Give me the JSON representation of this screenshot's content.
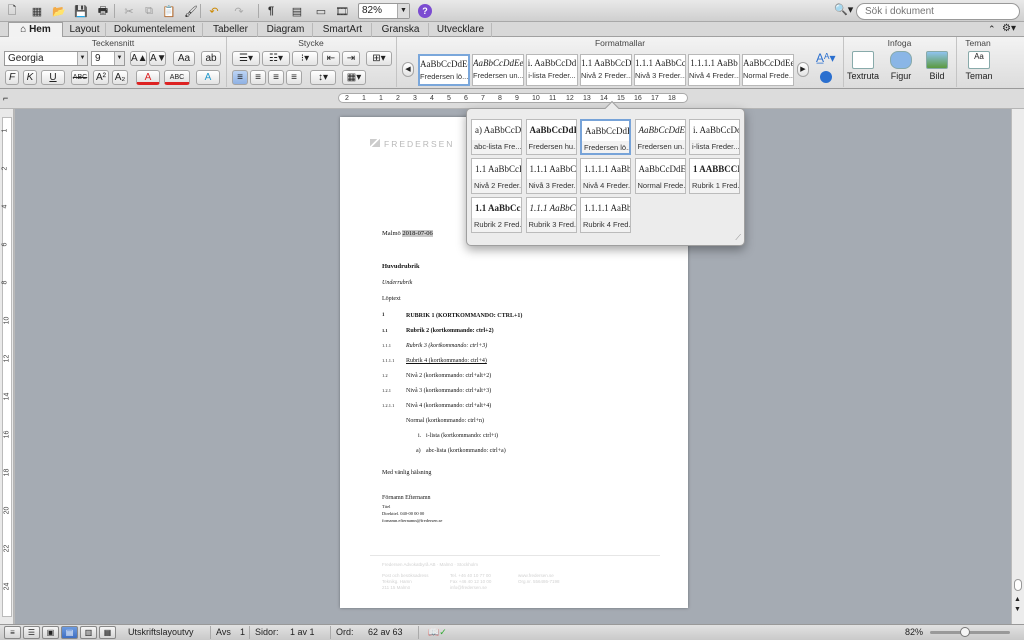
{
  "toolbar": {
    "zoom_value": "82%",
    "help_label": "?",
    "search_placeholder": "Sök i dokument",
    "icons": [
      "new-document-icon",
      "gallery-icon",
      "open-icon",
      "save-icon",
      "print-icon",
      "cut-icon",
      "copy-icon",
      "paste-icon",
      "format-painter-icon",
      "undo-icon",
      "redo-icon",
      "pilcrow-icon",
      "sidebar-icon",
      "view-icon",
      "media-icon",
      "help-icon"
    ]
  },
  "tabs": [
    {
      "label": "Hem",
      "active": true
    },
    {
      "label": "Layout"
    },
    {
      "label": "Dokumentelement"
    },
    {
      "label": "Tabeller"
    },
    {
      "label": "Diagram"
    },
    {
      "label": "SmartArt"
    },
    {
      "label": "Granska"
    },
    {
      "label": "Utvecklare"
    }
  ],
  "ribbon": {
    "groups": {
      "font": "Teckensnitt",
      "paragraph": "Stycke",
      "styles": "Formatmallar",
      "insert": "Infoga",
      "themes": "Teman"
    },
    "font_name": "Georgia",
    "font_size": "9",
    "font_buttons": [
      "A▲",
      "A▼",
      "Aa",
      "ab"
    ],
    "format_buttons": [
      "F",
      "K",
      "U",
      "ABC",
      "A²",
      "A₂",
      "A",
      "ABC",
      "A"
    ],
    "style_tiles": [
      {
        "preview": "AaBbCcDdEe",
        "name": "Fredersen lö...",
        "active": true
      },
      {
        "preview": "AaBbCcDdEe",
        "name": "Fredersen un..."
      },
      {
        "preview": "i.  AaBbCcDd",
        "name": "i-lista Freder..."
      },
      {
        "preview": "1.1  AaBbCcD",
        "name": "Nivå 2 Freder..."
      },
      {
        "preview": "1.1.1  AaBbCc",
        "name": "Nivå 3 Freder..."
      },
      {
        "preview": "1.1.1.1  AaBb",
        "name": "Nivå 4 Freder..."
      },
      {
        "preview": "AaBbCcDdEe",
        "name": "Normal Frede..."
      }
    ],
    "insert_buttons": [
      {
        "label": "Textruta"
      },
      {
        "label": "Figur"
      },
      {
        "label": "Bild"
      }
    ],
    "themes_button": "Teman"
  },
  "ruler": {
    "numbers": [
      "2",
      "1",
      "1",
      "2",
      "3",
      "4",
      "5",
      "6",
      "7",
      "8",
      "9",
      "10",
      "11",
      "12",
      "13",
      "14",
      "15",
      "16",
      "17",
      "18"
    ]
  },
  "vruler": {
    "numbers": [
      "1",
      "2",
      "4",
      "6",
      "8",
      "10",
      "12",
      "14",
      "16",
      "18",
      "20",
      "22",
      "24"
    ]
  },
  "document": {
    "logo": "FREDERSEN",
    "date_line": "Malmö",
    "date_value": "2018-07-06",
    "main_heading": "Huvudrubrik",
    "sub_heading": "Underrubrik",
    "body": "Löptext",
    "headings": [
      {
        "num": "1",
        "text": "RUBRIK 1 (KORTKOMMANDO: CTRL+1)"
      },
      {
        "num": "1.1",
        "text": "Rubrik 2 (kortkommando: ctrl+2)"
      },
      {
        "num": "1.1.1",
        "text": "Rubrik 3 (kortkommando: ctrl+3)"
      },
      {
        "num": "1.1.1.1",
        "text": "Rubrik 4 (kortkommando: ctrl+4)"
      },
      {
        "num": "1.2",
        "text": "Nivå 2 (kortkommando: ctrl+alt+2)"
      },
      {
        "num": "1.2.1",
        "text": "Nivå 3 (kortkommando: ctrl+alt+3)"
      },
      {
        "num": "1.2.1.1",
        "text": "Nivå 4 (kortkommando: ctrl+alt+4)"
      }
    ],
    "normal": "Normal (kortkommando: ctrl+n)",
    "ilist_num": "i.",
    "ilist": "i-lista (kortkommando: ctrl+i)",
    "abc_num": "a)",
    "abclist": "abc-lista (kortkommando: ctrl+a)",
    "closing": "Med vänlig hälsning",
    "signer": "Förnamn Efternamn",
    "signer_title": "Titel",
    "signer_phone": "Direkttel. 040-00 00 00",
    "signer_email": "fornamn.efternamn@fredersen.se",
    "footer": {
      "company": "Fredersen Advokatbyrå AB · Malmö · Stockholm",
      "col1": [
        "Post och besöksadress",
        "Teknikg. Hamn",
        "211 15 Malmö"
      ],
      "col2": [
        "Tel. +46 40 10 77 00",
        "Fax +46 40 12 10 00",
        "info@fredersen.se"
      ],
      "col3": [
        "www.fredersen.se",
        "Org.nr. 556486-7198",
        ""
      ]
    }
  },
  "popup": {
    "tiles": [
      {
        "preview": "a)  AaBbCcDc",
        "name": "abc-lista Fre..."
      },
      {
        "preview": "AaBbCcDdI",
        "name": "Fredersen hu...",
        "bold": true
      },
      {
        "preview": "AaBbCcDdEe",
        "name": "Fredersen lö...",
        "active": true
      },
      {
        "preview": "AaBbCcDdEe",
        "name": "Fredersen un...",
        "italic": true
      },
      {
        "preview": "i.  AaBbCcDd",
        "name": "i-lista Freder..."
      },
      {
        "preview": "1.1  AaBbCcD",
        "name": "Nivå 2 Freder..."
      },
      {
        "preview": "1.1.1  AaBbCc",
        "name": "Nivå 3 Freder..."
      },
      {
        "preview": "1.1.1.1  AaBb(",
        "name": "Nivå 4 Freder..."
      },
      {
        "preview": "AaBbCcDdEe",
        "name": "Normal Frede..."
      },
      {
        "preview": "1  AABBCCI",
        "name": "Rubrik 1 Fred...",
        "bold": true
      },
      {
        "preview": "1.1  AaBbCc",
        "name": "Rubrik 2 Fred...",
        "bold": true
      },
      {
        "preview": "1.1.1  AaBbCc",
        "name": "Rubrik 3 Fred...",
        "italic": true
      },
      {
        "preview": "1.1.1.1  AaBb(",
        "name": "Rubrik 4 Fred..."
      }
    ]
  },
  "status": {
    "view": "Utskriftslayoutvy",
    "section_label": "Avs",
    "section": "1",
    "pages_label": "Sidor:",
    "pages": "1 av 1",
    "words_label": "Ord:",
    "words": "62 av 63",
    "zoom": "82%"
  },
  "colors": {
    "accent": "#3f6fc2",
    "font_red": "#d22",
    "highlight": "#3b6fd4",
    "help": "#7b4bd1"
  }
}
